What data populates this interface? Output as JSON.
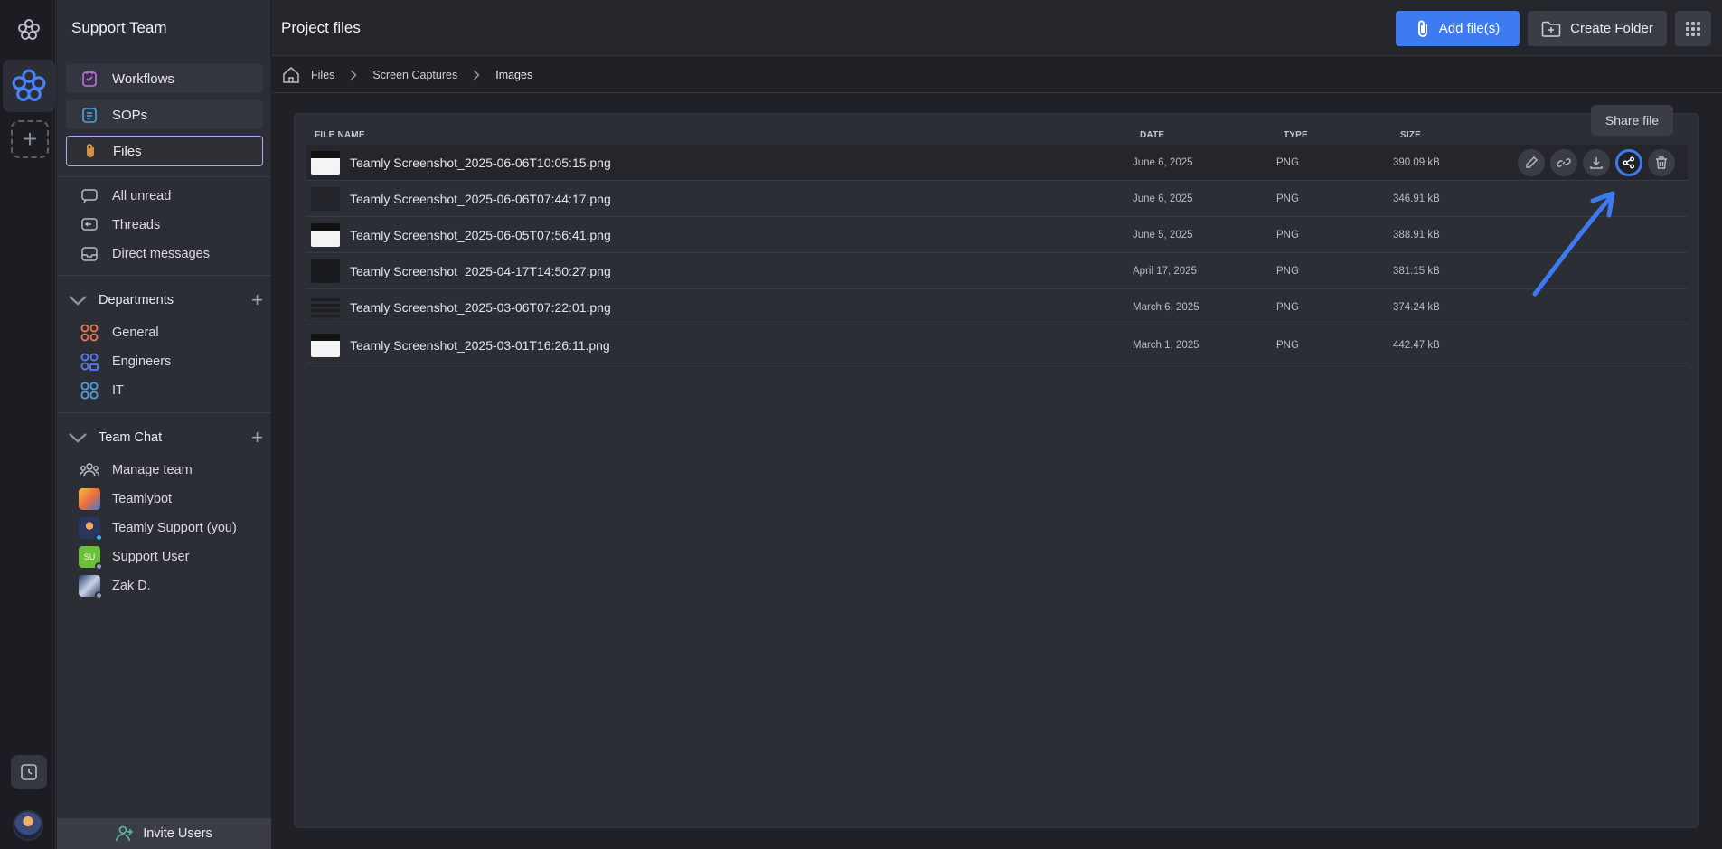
{
  "rail": {
    "logo_icon": "flower-icon",
    "workspace_icon": "flower-icon",
    "add_icon": "plus-icon",
    "history_icon": "clock-icon"
  },
  "sidebar": {
    "team_title": "Support Team",
    "main_nav": [
      {
        "label": "Workflows",
        "icon": "workflow-icon"
      },
      {
        "label": "SOPs",
        "icon": "clipboard-icon"
      },
      {
        "label": "Files",
        "icon": "paperclip-icon",
        "active": true
      }
    ],
    "inbox": [
      {
        "label": "All unread",
        "icon": "chat-bubble-icon"
      },
      {
        "label": "Threads",
        "icon": "threads-icon"
      },
      {
        "label": "Direct messages",
        "icon": "inbox-icon"
      }
    ],
    "departments": {
      "title": "Departments",
      "items": [
        {
          "label": "General",
          "color": "#e9784c"
        },
        {
          "label": "Engineers",
          "color": "#5b7ef0"
        },
        {
          "label": "IT",
          "color": "#4aa3e0"
        }
      ]
    },
    "team_chat": {
      "title": "Team Chat",
      "items": [
        {
          "label": "Manage team"
        },
        {
          "label": "Teamlybot"
        },
        {
          "label": "Teamly Support (you)"
        },
        {
          "label": "Support User",
          "initials": "SU"
        },
        {
          "label": "Zak D."
        }
      ]
    },
    "invite_label": "Invite Users"
  },
  "header": {
    "title": "Project files",
    "add_label": "Add file(s)",
    "folder_label": "Create Folder"
  },
  "breadcrumb": [
    "Files",
    "Screen Captures",
    "Images"
  ],
  "table": {
    "columns": [
      "FILE NAME",
      "DATE",
      "TYPE",
      "SIZE"
    ],
    "rows": [
      {
        "name": "Teamly Screenshot_2025-06-06T10:05:15.png",
        "date": "June 6, 2025",
        "type": "PNG",
        "size": "390.09 kB"
      },
      {
        "name": "Teamly Screenshot_2025-06-06T07:44:17.png",
        "date": "June 6, 2025",
        "type": "PNG",
        "size": "346.91 kB"
      },
      {
        "name": "Teamly Screenshot_2025-06-05T07:56:41.png",
        "date": "June 5, 2025",
        "type": "PNG",
        "size": "388.91 kB"
      },
      {
        "name": "Teamly Screenshot_2025-04-17T14:50:27.png",
        "date": "April 17, 2025",
        "type": "PNG",
        "size": "381.15 kB"
      },
      {
        "name": "Teamly Screenshot_2025-03-06T07:22:01.png",
        "date": "March 6, 2025",
        "type": "PNG",
        "size": "374.24 kB"
      },
      {
        "name": "Teamly Screenshot_2025-03-01T16:26:11.png",
        "date": "March 1, 2025",
        "type": "PNG",
        "size": "442.47 kB"
      }
    ],
    "row_actions": [
      "pencil-icon",
      "link-icon",
      "download-icon",
      "share-icon",
      "trash-icon"
    ]
  },
  "tooltip": "Share file",
  "colors": {
    "accent": "#3f7bf0",
    "active_border": "#b9a7ff"
  }
}
